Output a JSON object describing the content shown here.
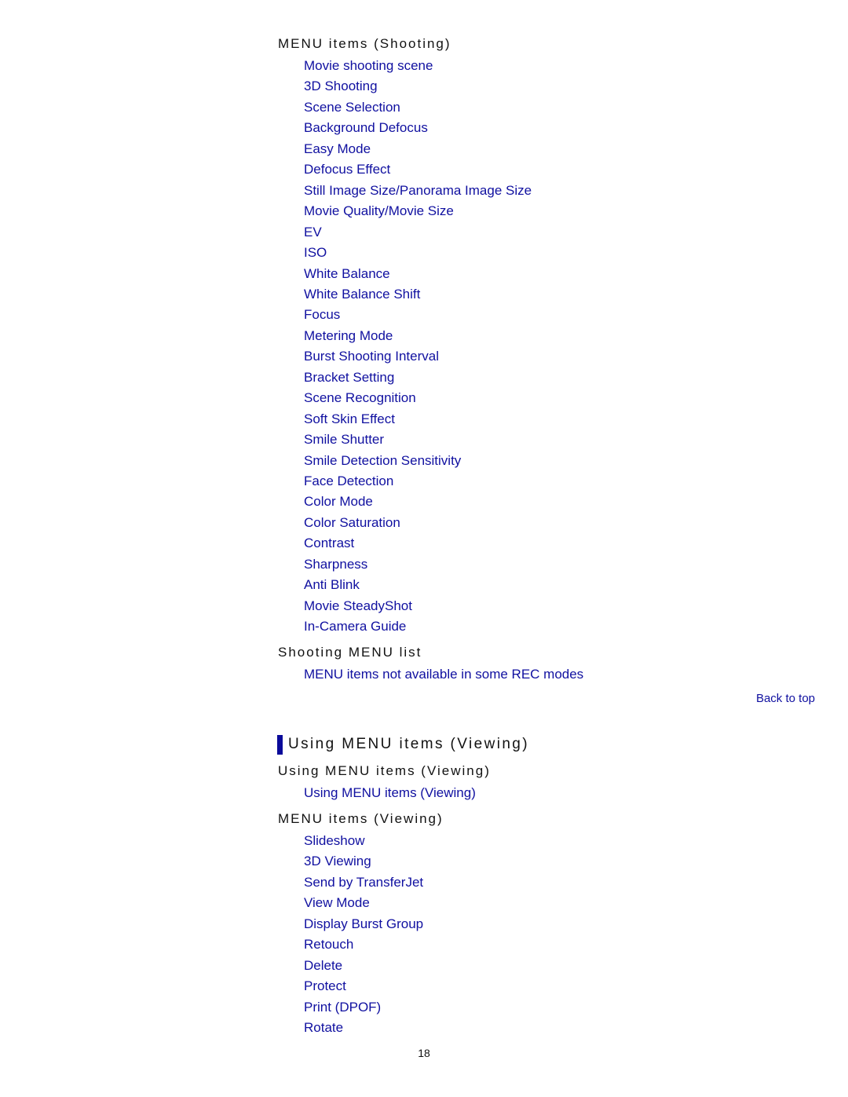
{
  "shooting": {
    "menu_items_heading": "MENU items (Shooting)",
    "menu_items": [
      "Movie shooting scene",
      "3D Shooting",
      "Scene Selection",
      "Background Defocus",
      "Easy Mode",
      "Defocus Effect",
      "Still Image Size/Panorama Image Size",
      "Movie Quality/Movie Size",
      "EV",
      "ISO",
      "White Balance",
      "White Balance Shift",
      "Focus",
      "Metering Mode",
      "Burst Shooting Interval",
      "Bracket Setting",
      "Scene Recognition",
      "Soft Skin Effect",
      "Smile Shutter",
      "Smile Detection Sensitivity",
      "Face Detection",
      "Color Mode",
      "Color Saturation",
      "Contrast",
      "Sharpness",
      "Anti Blink",
      "Movie SteadyShot",
      "In-Camera Guide"
    ],
    "list_heading": "Shooting MENU list",
    "list_items": [
      "MENU items not available in some REC modes"
    ]
  },
  "back_to_top": "Back to top",
  "viewing": {
    "section_title": "Using MENU items (Viewing)",
    "using_heading": "Using MENU items (Viewing)",
    "using_items": [
      "Using MENU items (Viewing)"
    ],
    "menu_items_heading": "MENU items (Viewing)",
    "menu_items": [
      "Slideshow",
      "3D Viewing",
      "Send by TransferJet",
      "View Mode",
      "Display Burst Group",
      "Retouch",
      "Delete",
      "Protect",
      "Print (DPOF)",
      "Rotate"
    ]
  },
  "page_number": "18",
  "colors": {
    "link": "#1010a0",
    "section_bar": "#0a0a9a",
    "text": "#111111"
  }
}
